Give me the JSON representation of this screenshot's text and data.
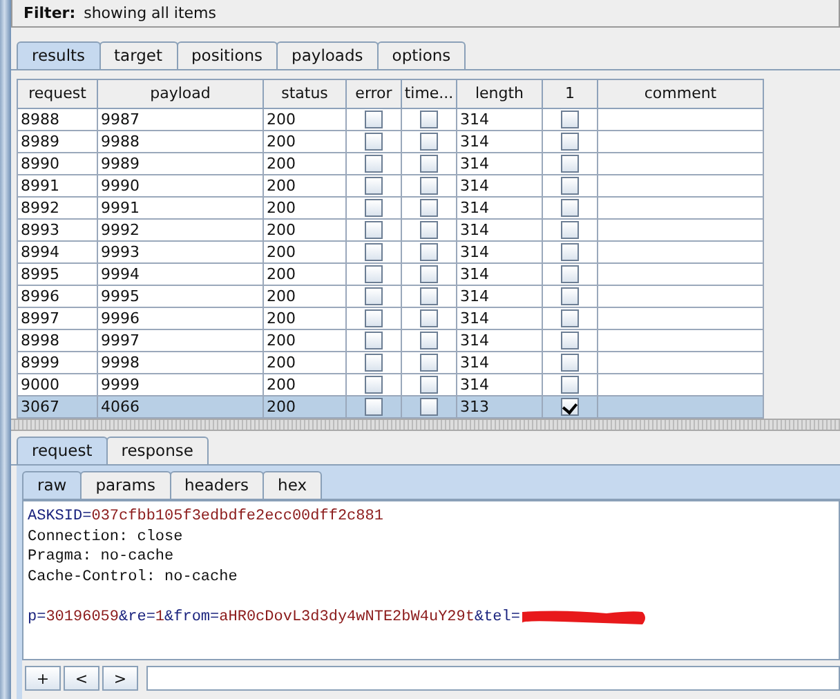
{
  "filter": {
    "label": "Filter:",
    "value": "showing all items"
  },
  "tabs": [
    {
      "label": "results",
      "selected": true
    },
    {
      "label": "target",
      "selected": false
    },
    {
      "label": "positions",
      "selected": false
    },
    {
      "label": "payloads",
      "selected": false
    },
    {
      "label": "options",
      "selected": false
    }
  ],
  "table": {
    "columns": [
      "request",
      "payload",
      "status",
      "error",
      "time...",
      "length",
      "1",
      "comment"
    ],
    "rows": [
      {
        "request": "8988",
        "payload": "9987",
        "status": "200",
        "error": false,
        "timeout": false,
        "length": "314",
        "match": false,
        "selected": false
      },
      {
        "request": "8989",
        "payload": "9988",
        "status": "200",
        "error": false,
        "timeout": false,
        "length": "314",
        "match": false,
        "selected": false
      },
      {
        "request": "8990",
        "payload": "9989",
        "status": "200",
        "error": false,
        "timeout": false,
        "length": "314",
        "match": false,
        "selected": false
      },
      {
        "request": "8991",
        "payload": "9990",
        "status": "200",
        "error": false,
        "timeout": false,
        "length": "314",
        "match": false,
        "selected": false
      },
      {
        "request": "8992",
        "payload": "9991",
        "status": "200",
        "error": false,
        "timeout": false,
        "length": "314",
        "match": false,
        "selected": false
      },
      {
        "request": "8993",
        "payload": "9992",
        "status": "200",
        "error": false,
        "timeout": false,
        "length": "314",
        "match": false,
        "selected": false
      },
      {
        "request": "8994",
        "payload": "9993",
        "status": "200",
        "error": false,
        "timeout": false,
        "length": "314",
        "match": false,
        "selected": false
      },
      {
        "request": "8995",
        "payload": "9994",
        "status": "200",
        "error": false,
        "timeout": false,
        "length": "314",
        "match": false,
        "selected": false
      },
      {
        "request": "8996",
        "payload": "9995",
        "status": "200",
        "error": false,
        "timeout": false,
        "length": "314",
        "match": false,
        "selected": false
      },
      {
        "request": "8997",
        "payload": "9996",
        "status": "200",
        "error": false,
        "timeout": false,
        "length": "314",
        "match": false,
        "selected": false
      },
      {
        "request": "8998",
        "payload": "9997",
        "status": "200",
        "error": false,
        "timeout": false,
        "length": "314",
        "match": false,
        "selected": false
      },
      {
        "request": "8999",
        "payload": "9998",
        "status": "200",
        "error": false,
        "timeout": false,
        "length": "314",
        "match": false,
        "selected": false
      },
      {
        "request": "9000",
        "payload": "9999",
        "status": "200",
        "error": false,
        "timeout": false,
        "length": "314",
        "match": false,
        "selected": false
      },
      {
        "request": "3067",
        "payload": "4066",
        "status": "200",
        "error": false,
        "timeout": false,
        "length": "313",
        "match": true,
        "selected": true
      }
    ]
  },
  "message_tabs": [
    {
      "label": "request",
      "selected": true
    },
    {
      "label": "response",
      "selected": false
    }
  ],
  "view_tabs": [
    {
      "label": "raw",
      "selected": true
    },
    {
      "label": "params",
      "selected": false
    },
    {
      "label": "headers",
      "selected": false
    },
    {
      "label": "hex",
      "selected": false
    }
  ],
  "editor": {
    "lines": [
      {
        "segments": [
          {
            "text": "ASKSID=",
            "kind": "key"
          },
          {
            "text": "037cfbb105f3edbdfe2ecc00dff2c881",
            "kind": "value"
          }
        ]
      },
      {
        "segments": [
          {
            "text": "Connection: close",
            "kind": "plain"
          }
        ]
      },
      {
        "segments": [
          {
            "text": "Pragma: no-cache",
            "kind": "plain"
          }
        ]
      },
      {
        "segments": [
          {
            "text": "Cache-Control: no-cache",
            "kind": "plain"
          }
        ]
      },
      {
        "blank_before": true,
        "segments": [
          {
            "text": "p=",
            "kind": "key"
          },
          {
            "text": "30196059",
            "kind": "value"
          },
          {
            "text": "&re=",
            "kind": "key"
          },
          {
            "text": "1",
            "kind": "value"
          },
          {
            "text": "&from=",
            "kind": "key"
          },
          {
            "text": "aHR0cDovL3d3dy4wNTE2bW4uY29t",
            "kind": "value"
          },
          {
            "text": "&tel=",
            "kind": "key"
          }
        ],
        "redacted": true
      }
    ]
  },
  "search_buttons": [
    "+",
    "<",
    ">"
  ]
}
